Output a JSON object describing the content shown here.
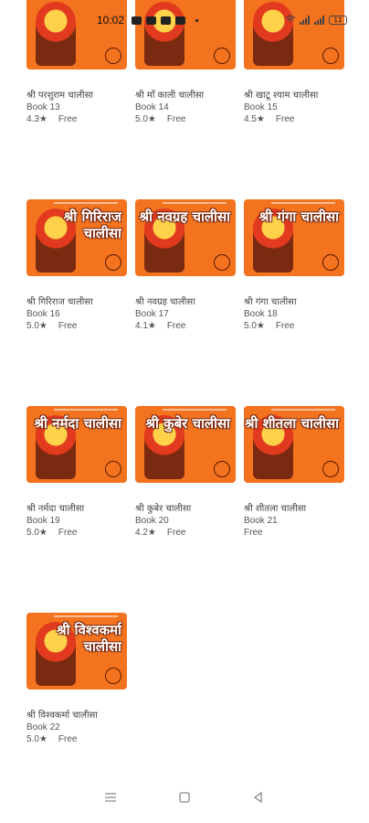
{
  "status_bar": {
    "time": "10:02",
    "battery": "11"
  },
  "books": [
    {
      "name": "श्री परशुराम चालीसा",
      "book": "Book 13",
      "rating": "4.3★",
      "price": "Free",
      "thumb_title": "",
      "thumb_color": "#f4731f"
    },
    {
      "name": "श्री माँ काली चालीसा",
      "book": "Book 14",
      "rating": "5.0★",
      "price": "Free",
      "thumb_title": "",
      "thumb_color": "#f4731f"
    },
    {
      "name": "श्री खाटू श्याम चालीसा",
      "book": "Book 15",
      "rating": "4.5★",
      "price": "Free",
      "thumb_title": "",
      "thumb_color": "#f4731f"
    },
    {
      "name": "श्री गिरिराज चालीसा",
      "book": "Book 16",
      "rating": "5.0★",
      "price": "Free",
      "thumb_title": "श्री गिरिराज चालीसा",
      "thumb_color": "#f4731f"
    },
    {
      "name": "श्री नवग्रह चालीसा",
      "book": "Book 17",
      "rating": "4.1★",
      "price": "Free",
      "thumb_title": "श्री नवग्रह चालीसा",
      "thumb_color": "#f4731f"
    },
    {
      "name": "श्री गंगा चालीसा",
      "book": "Book 18",
      "rating": "5.0★",
      "price": "Free",
      "thumb_title": "श्री गंगा चालीसा",
      "thumb_color": "#f4731f"
    },
    {
      "name": "श्री नर्मदा चालीसा",
      "book": "Book 19",
      "rating": "5.0★",
      "price": "Free",
      "thumb_title": "श्री नर्मदा चालीसा",
      "thumb_color": "#f4731f"
    },
    {
      "name": "श्री कुबेर चालीसा",
      "book": "Book 20",
      "rating": "4.2★",
      "price": "Free",
      "thumb_title": "श्री कुबेर चालीसा",
      "thumb_color": "#f4731f"
    },
    {
      "name": "श्री शीतला चालीसा",
      "book": "Book 21",
      "rating": "",
      "price": "Free",
      "thumb_title": "श्री शीतला चालीसा",
      "thumb_color": "#f4731f"
    },
    {
      "name": "श्री विश्वकर्मा चालीसा",
      "book": "Book 22",
      "rating": "5.0★",
      "price": "Free",
      "thumb_title": "श्री विश्वकर्मा चालीसा",
      "thumb_color": "#f4731f"
    }
  ],
  "nav": {
    "icons": [
      "menu-icon",
      "home-square-icon",
      "back-triangle-icon"
    ]
  }
}
